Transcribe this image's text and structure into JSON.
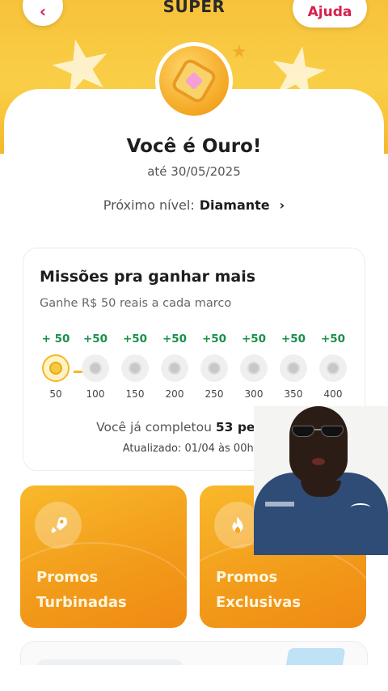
{
  "header": {
    "title": "SUPER",
    "back_label": "‹",
    "help_label": "Ajuda"
  },
  "level": {
    "title": "Você é Ouro!",
    "until": "até 30/05/2025",
    "next_label": "Próximo nível:",
    "next_value": "Diamante",
    "next_chevron": "›"
  },
  "missions": {
    "title": "Missões pra ganhar mais",
    "subtitle": "Ganhe R$ 50 reais a cada marco",
    "steps": [
      {
        "bonus": "+ 50",
        "label": "50",
        "done": true
      },
      {
        "bonus": "+50",
        "label": "100",
        "done": false
      },
      {
        "bonus": "+50",
        "label": "150",
        "done": false
      },
      {
        "bonus": "+50",
        "label": "200",
        "done": false
      },
      {
        "bonus": "+50",
        "label": "250",
        "done": false
      },
      {
        "bonus": "+50",
        "label": "300",
        "done": false
      },
      {
        "bonus": "+50",
        "label": "350",
        "done": false
      },
      {
        "bonus": "+50",
        "label": "400",
        "done": false
      }
    ],
    "completed_prefix": "Você já completou",
    "completed_value": "53 pedidos",
    "updated": "Atualizado: 01/04 às 00h00"
  },
  "promos": [
    {
      "line1": "Promos",
      "line2": "Turbinadas",
      "icon": "rocket-icon"
    },
    {
      "line1": "Promos",
      "line2": "Exclusivas",
      "icon": "flame-icon"
    }
  ],
  "colors": {
    "accent": "#d6204f",
    "gold": "#f7c23a",
    "green": "#1a8f4a",
    "promo": "#f29a1a"
  }
}
